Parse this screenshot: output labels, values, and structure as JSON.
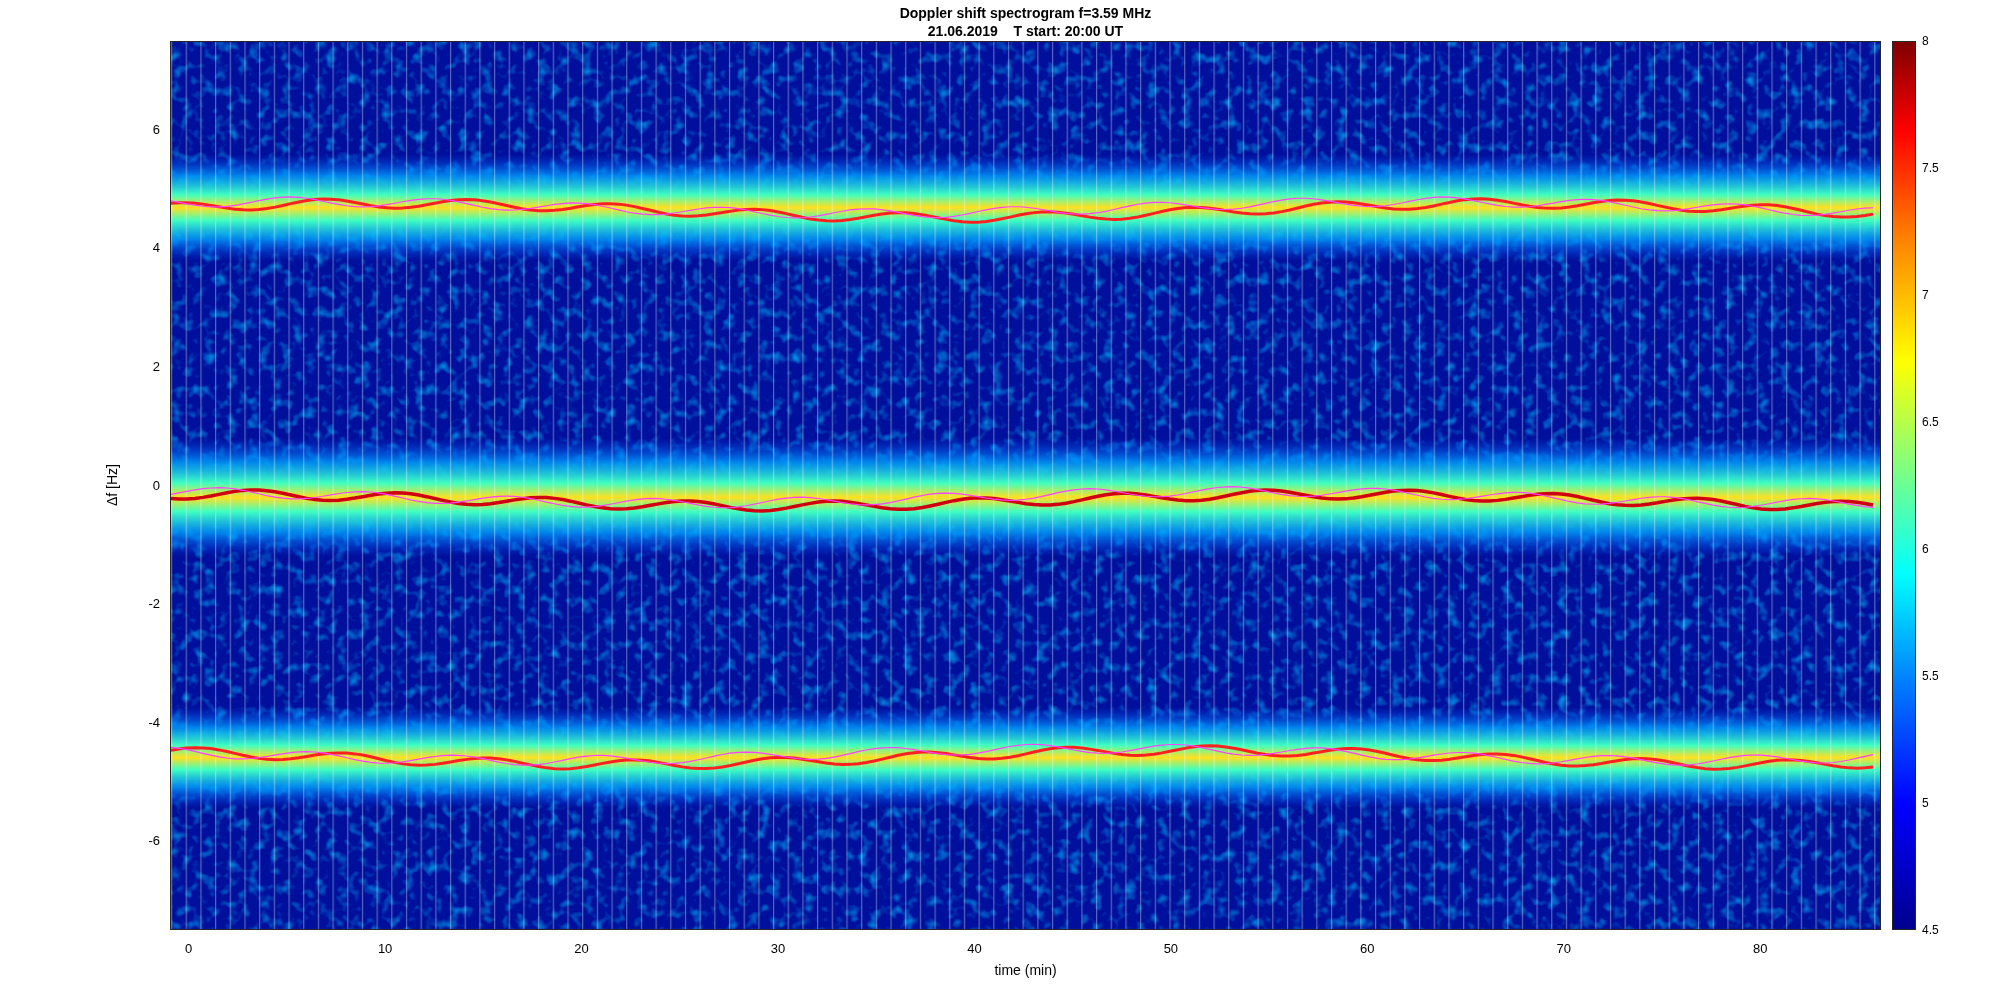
{
  "figure": {
    "title_lines": [
      "Doppler shift spectrogram f=3.59 MHz",
      "21.06.2019    T start: 20:00 UT"
    ]
  },
  "axes": {
    "xlabel": "time (min)",
    "ylabel": "Δf [Hz]",
    "xticks": [
      "0",
      "10",
      "20",
      "30",
      "40",
      "50",
      "60",
      "70",
      "80"
    ],
    "yticks": [
      "6",
      "4",
      "2",
      "0",
      "-2",
      "-4",
      "-6"
    ]
  },
  "colorbar": {
    "ticks": [
      "8",
      "7.5",
      "7",
      "6.5",
      "6",
      "5.5",
      "5",
      "4.5"
    ]
  }
}
